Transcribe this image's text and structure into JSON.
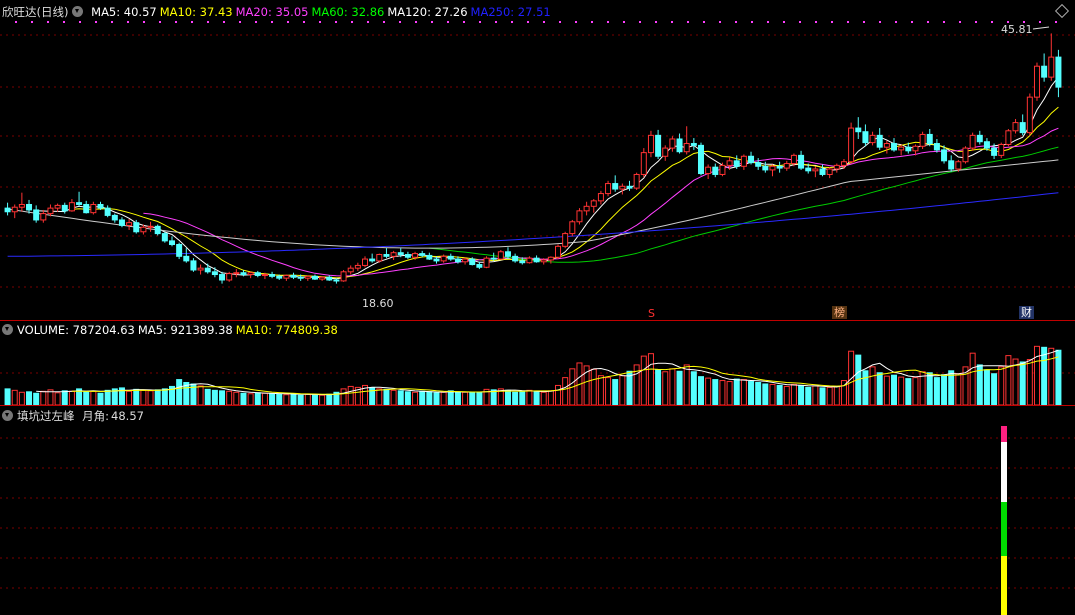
{
  "main": {
    "stock_name": "欣旺达(日线)",
    "ma": [
      {
        "label": "MA5:",
        "value": "40.57",
        "color": "#ffffff"
      },
      {
        "label": "MA10:",
        "value": "37.43",
        "color": "#ffff00"
      },
      {
        "label": "MA20:",
        "value": "35.05",
        "color": "#ff40ff"
      },
      {
        "label": "MA60:",
        "value": "32.86",
        "color": "#00ff00"
      },
      {
        "label": "MA120:",
        "value": "27.26",
        "color": "#ffffff"
      },
      {
        "label": "MA250:",
        "value": "27.51",
        "color": "#2020ff"
      }
    ],
    "high_label": "45.81",
    "low_label": "18.60",
    "markers": [
      {
        "text": "S",
        "color": "#ff3030"
      },
      {
        "text": "榜",
        "color": "#ffb080"
      },
      {
        "text": "财",
        "color": "#ffffff"
      }
    ]
  },
  "volume": {
    "items": [
      {
        "label": "VOLUME:",
        "value": "787204.63",
        "color": "#ffffff"
      },
      {
        "label": "MA5:",
        "value": "921389.38",
        "color": "#ffffff"
      },
      {
        "label": "MA10:",
        "value": "774809.38",
        "color": "#ffff00"
      }
    ]
  },
  "indicator": {
    "name": "填坑过左峰",
    "label": "月角:",
    "value": "48.57",
    "bar_colors": [
      "#ff2080",
      "#ffffff",
      "#00dd00",
      "#ffff00"
    ]
  },
  "chart_data": {
    "type": "candlestick",
    "price_range": [
      16.5,
      47.5
    ],
    "candles": [
      [
        26.6,
        27.2,
        25.8,
        26.2
      ],
      [
        26.2,
        27.0,
        25.5,
        26.7
      ],
      [
        26.7,
        28.3,
        26.2,
        27.0
      ],
      [
        27.0,
        27.5,
        26.0,
        26.4
      ],
      [
        26.4,
        26.9,
        25.0,
        25.3
      ],
      [
        25.3,
        26.4,
        25.0,
        26.0
      ],
      [
        26.0,
        27.0,
        25.7,
        26.6
      ],
      [
        26.6,
        27.1,
        26.2,
        26.9
      ],
      [
        26.9,
        27.2,
        26.0,
        26.3
      ],
      [
        26.3,
        27.6,
        26.2,
        27.2
      ],
      [
        27.2,
        28.4,
        26.8,
        27.0
      ],
      [
        27.0,
        27.4,
        26.0,
        26.1
      ],
      [
        26.1,
        27.3,
        25.9,
        27.0
      ],
      [
        27.0,
        27.3,
        26.4,
        26.6
      ],
      [
        26.6,
        26.9,
        25.6,
        25.8
      ],
      [
        25.8,
        26.0,
        25.0,
        25.3
      ],
      [
        25.3,
        25.6,
        24.5,
        24.7
      ],
      [
        24.7,
        25.4,
        24.2,
        25.0
      ],
      [
        25.0,
        25.3,
        23.8,
        24.0
      ],
      [
        24.0,
        24.8,
        23.7,
        24.5
      ],
      [
        24.5,
        25.1,
        24.0,
        24.6
      ],
      [
        24.6,
        24.8,
        23.6,
        23.8
      ],
      [
        23.8,
        24.0,
        22.8,
        23.0
      ],
      [
        23.0,
        23.5,
        22.4,
        22.6
      ],
      [
        22.6,
        22.8,
        21.0,
        21.3
      ],
      [
        21.3,
        22.2,
        20.6,
        20.8
      ],
      [
        20.8,
        21.1,
        19.6,
        19.8
      ],
      [
        19.8,
        20.4,
        19.3,
        20.0
      ],
      [
        20.0,
        20.5,
        19.4,
        19.6
      ],
      [
        19.6,
        20.1,
        19.0,
        19.3
      ],
      [
        19.3,
        19.6,
        18.3,
        18.7
      ],
      [
        18.7,
        19.6,
        18.5,
        19.4
      ],
      [
        19.4,
        19.9,
        19.0,
        19.5
      ],
      [
        19.5,
        19.8,
        19.1,
        19.3
      ],
      [
        19.3,
        19.6,
        18.9,
        19.5
      ],
      [
        19.5,
        19.7,
        19.0,
        19.2
      ],
      [
        19.2,
        19.5,
        18.8,
        19.3
      ],
      [
        19.3,
        19.6,
        18.9,
        19.1
      ],
      [
        19.1,
        19.3,
        18.7,
        18.9
      ],
      [
        18.9,
        19.3,
        18.6,
        19.2
      ],
      [
        19.2,
        19.5,
        18.8,
        19.0
      ],
      [
        19.0,
        19.3,
        18.6,
        18.9
      ],
      [
        18.9,
        19.2,
        18.6,
        19.1
      ],
      [
        19.1,
        19.3,
        18.7,
        18.8
      ],
      [
        18.8,
        19.1,
        18.6,
        19.0
      ],
      [
        19.0,
        19.2,
        18.6,
        18.7
      ],
      [
        18.7,
        18.9,
        18.3,
        18.6
      ],
      [
        18.6,
        19.8,
        18.5,
        19.6
      ],
      [
        19.6,
        20.3,
        19.3,
        20.0
      ],
      [
        20.0,
        20.6,
        19.7,
        20.3
      ],
      [
        20.3,
        21.3,
        20.1,
        21.0
      ],
      [
        21.0,
        21.6,
        20.6,
        20.8
      ],
      [
        20.8,
        21.6,
        20.6,
        21.5
      ],
      [
        21.5,
        22.2,
        21.1,
        21.3
      ],
      [
        21.3,
        21.9,
        20.9,
        21.7
      ],
      [
        21.7,
        22.2,
        21.2,
        21.5
      ],
      [
        21.5,
        21.8,
        21.0,
        21.2
      ],
      [
        21.2,
        21.8,
        20.9,
        21.6
      ],
      [
        21.6,
        21.9,
        21.2,
        21.4
      ],
      [
        21.4,
        21.7,
        20.9,
        21.0
      ],
      [
        21.0,
        21.3,
        20.5,
        20.8
      ],
      [
        20.8,
        21.5,
        20.6,
        21.3
      ],
      [
        21.3,
        21.6,
        20.8,
        21.0
      ],
      [
        21.0,
        21.3,
        20.5,
        20.7
      ],
      [
        20.7,
        21.2,
        20.4,
        21.0
      ],
      [
        21.0,
        21.2,
        20.3,
        20.4
      ],
      [
        20.4,
        20.7,
        19.9,
        20.1
      ],
      [
        20.1,
        21.3,
        20.0,
        21.1
      ],
      [
        21.1,
        21.7,
        20.8,
        21.0
      ],
      [
        21.0,
        22.0,
        20.9,
        21.8
      ],
      [
        21.8,
        22.3,
        21.0,
        21.3
      ],
      [
        21.3,
        21.6,
        20.6,
        20.8
      ],
      [
        20.8,
        21.2,
        20.4,
        20.6
      ],
      [
        20.6,
        21.3,
        20.5,
        21.1
      ],
      [
        21.1,
        21.4,
        20.6,
        20.7
      ],
      [
        20.7,
        21.1,
        20.4,
        20.9
      ],
      [
        20.9,
        21.3,
        20.5,
        21.2
      ],
      [
        21.2,
        22.6,
        21.0,
        22.4
      ],
      [
        22.4,
        24.0,
        22.2,
        23.8
      ],
      [
        23.8,
        25.3,
        23.5,
        25.1
      ],
      [
        25.1,
        26.6,
        24.8,
        26.3
      ],
      [
        26.3,
        27.3,
        25.8,
        26.8
      ],
      [
        26.8,
        27.6,
        26.1,
        27.4
      ],
      [
        27.4,
        28.5,
        27.0,
        28.2
      ],
      [
        28.2,
        29.6,
        27.9,
        29.3
      ],
      [
        29.3,
        30.2,
        28.4,
        28.7
      ],
      [
        28.7,
        29.3,
        28.1,
        29.0
      ],
      [
        29.0,
        29.6,
        28.5,
        28.8
      ],
      [
        28.8,
        30.5,
        28.6,
        30.3
      ],
      [
        30.3,
        33.2,
        30.0,
        32.7
      ],
      [
        32.7,
        35.1,
        32.2,
        34.6
      ],
      [
        34.6,
        35.2,
        32.0,
        32.3
      ],
      [
        32.3,
        33.5,
        31.8,
        33.2
      ],
      [
        33.2,
        34.5,
        32.8,
        34.2
      ],
      [
        34.2,
        34.8,
        32.6,
        32.8
      ],
      [
        32.8,
        35.6,
        32.5,
        33.7
      ],
      [
        33.7,
        34.3,
        33.0,
        33.5
      ],
      [
        33.5,
        33.8,
        30.2,
        30.4
      ],
      [
        30.4,
        31.4,
        29.8,
        31.1
      ],
      [
        31.1,
        31.5,
        30.0,
        30.3
      ],
      [
        30.3,
        31.6,
        30.1,
        31.3
      ],
      [
        31.3,
        32.2,
        30.8,
        31.8
      ],
      [
        31.8,
        32.4,
        30.9,
        31.2
      ],
      [
        31.2,
        32.5,
        30.8,
        32.3
      ],
      [
        32.3,
        32.8,
        31.4,
        31.6
      ],
      [
        31.6,
        32.1,
        30.8,
        31.2
      ],
      [
        31.2,
        31.7,
        30.5,
        30.8
      ],
      [
        30.8,
        31.4,
        30.1,
        31.2
      ],
      [
        31.2,
        31.7,
        30.5,
        31.0
      ],
      [
        31.0,
        31.8,
        30.7,
        31.5
      ],
      [
        31.5,
        32.6,
        31.2,
        32.4
      ],
      [
        32.4,
        32.9,
        30.8,
        31.0
      ],
      [
        31.0,
        31.5,
        30.4,
        30.7
      ],
      [
        30.7,
        31.2,
        30.0,
        30.9
      ],
      [
        30.9,
        31.4,
        30.1,
        30.3
      ],
      [
        30.3,
        31.1,
        29.9,
        30.9
      ],
      [
        30.9,
        31.5,
        30.5,
        31.3
      ],
      [
        31.3,
        32.0,
        30.9,
        31.7
      ],
      [
        31.7,
        36.0,
        31.5,
        35.4
      ],
      [
        35.4,
        36.6,
        34.2,
        35.0
      ],
      [
        35.0,
        35.8,
        33.4,
        33.8
      ],
      [
        33.8,
        35.0,
        33.5,
        34.6
      ],
      [
        34.6,
        35.4,
        33.0,
        33.3
      ],
      [
        33.3,
        34.0,
        32.6,
        33.7
      ],
      [
        33.7,
        34.3,
        32.8,
        33.0
      ],
      [
        33.0,
        33.6,
        32.4,
        33.3
      ],
      [
        33.3,
        33.8,
        32.6,
        32.9
      ],
      [
        32.9,
        33.6,
        32.4,
        33.4
      ],
      [
        33.4,
        35.0,
        33.1,
        34.7
      ],
      [
        34.7,
        35.3,
        33.4,
        33.7
      ],
      [
        33.7,
        34.2,
        32.7,
        33.0
      ],
      [
        33.0,
        33.5,
        31.5,
        31.8
      ],
      [
        31.8,
        32.4,
        30.6,
        30.9
      ],
      [
        30.9,
        31.9,
        30.6,
        31.7
      ],
      [
        31.7,
        33.4,
        31.5,
        33.2
      ],
      [
        33.2,
        34.9,
        32.9,
        34.6
      ],
      [
        34.6,
        35.1,
        33.6,
        33.9
      ],
      [
        33.9,
        34.3,
        32.9,
        33.2
      ],
      [
        33.2,
        33.7,
        32.0,
        32.4
      ],
      [
        32.4,
        33.8,
        32.1,
        33.6
      ],
      [
        33.6,
        35.3,
        33.4,
        35.1
      ],
      [
        35.1,
        36.4,
        34.8,
        36.0
      ],
      [
        36.0,
        36.9,
        34.6,
        34.9
      ],
      [
        34.9,
        39.2,
        34.6,
        38.8
      ],
      [
        38.8,
        42.6,
        38.4,
        42.2
      ],
      [
        42.2,
        43.6,
        40.5,
        41.0
      ],
      [
        41.0,
        45.81,
        40.6,
        43.2
      ],
      [
        43.2,
        44.0,
        38.8,
        39.9
      ]
    ],
    "volume_range": [
      0,
      1350000
    ],
    "volumes": [
      330000,
      300000,
      260000,
      270000,
      240000,
      280000,
      310000,
      250000,
      290000,
      280000,
      330000,
      270000,
      280000,
      240000,
      300000,
      330000,
      350000,
      280000,
      320000,
      300000,
      290000,
      310000,
      330000,
      380000,
      520000,
      460000,
      430000,
      390000,
      320000,
      300000,
      290000,
      280000,
      260000,
      240000,
      230000,
      250000,
      240000,
      230000,
      220000,
      210000,
      230000,
      200000,
      220000,
      210000,
      200000,
      220000,
      260000,
      330000,
      380000,
      360000,
      400000,
      350000,
      330000,
      320000,
      300000,
      290000,
      270000,
      260000,
      280000,
      270000,
      250000,
      260000,
      290000,
      270000,
      260000,
      250000,
      260000,
      320000,
      310000,
      330000,
      300000,
      260000,
      270000,
      300000,
      280000,
      260000,
      290000,
      400000,
      560000,
      740000,
      860000,
      800000,
      730000,
      600000,
      560000,
      520000,
      600000,
      690000,
      820000,
      1000000,
      1050000,
      720000,
      680000,
      740000,
      690000,
      820000,
      680000,
      580000,
      550000,
      520000,
      500000,
      480000,
      530000,
      520000,
      480000,
      460000,
      430000,
      420000,
      400000,
      380000,
      420000,
      400000,
      360000,
      390000,
      350000,
      360000,
      380000,
      500000,
      1100000,
      1020000,
      700000,
      780000,
      660000,
      590000,
      610000,
      570000,
      540000,
      560000,
      680000,
      660000,
      560000,
      620000,
      700000,
      640000,
      780000,
      1060000,
      820000,
      720000,
      640000,
      780000,
      1010000,
      940000,
      880000,
      930000,
      1200000,
      1180000,
      1160000,
      1120000
    ]
  }
}
